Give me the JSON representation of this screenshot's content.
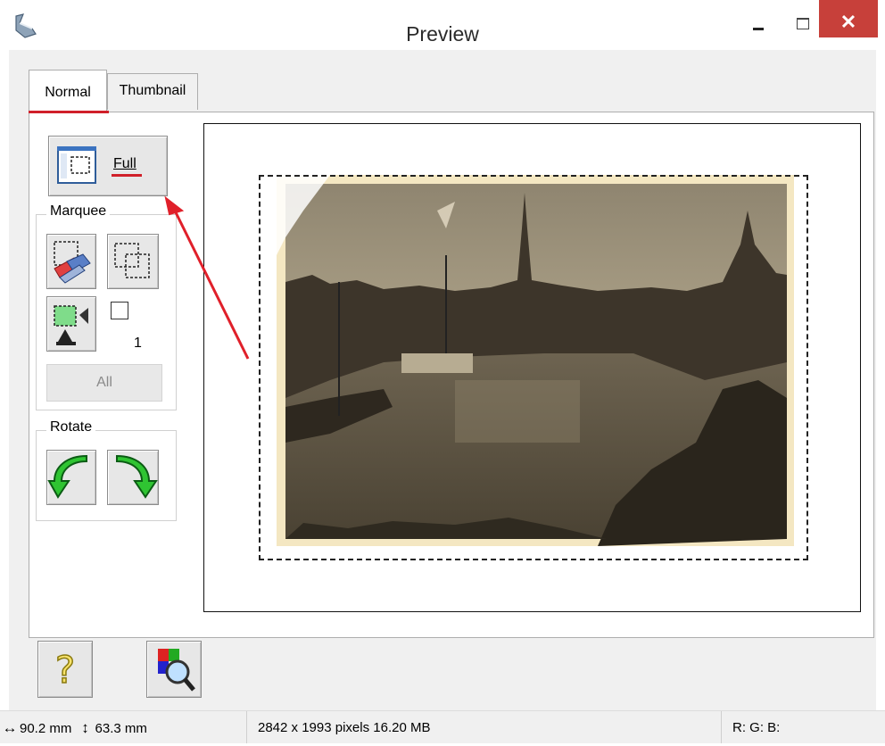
{
  "window": {
    "title": "Preview",
    "icons": {
      "app": "scanner-hand-icon",
      "minimize": "minimize-icon",
      "maximize": "maximize-icon",
      "close": "close-icon"
    },
    "close_glyph": "✕"
  },
  "tabs": [
    {
      "label": "Normal",
      "selected": true
    },
    {
      "label": "Thumbnail",
      "selected": false
    }
  ],
  "controls": {
    "full_button": {
      "label": "Full",
      "icon": "full-preview-icon"
    },
    "marquee": {
      "legend": "Marquee",
      "erase_icon": "erase-marquee-icon",
      "copy_icon": "copy-marquee-icon",
      "auto_exposure_icon": "auto-exposure-icon",
      "count": "1",
      "all_label": "All"
    },
    "rotate": {
      "legend": "Rotate",
      "left_icon": "rotate-left-icon",
      "right_icon": "rotate-right-icon"
    }
  },
  "preview": {
    "image": "sepia-harbor-photo",
    "marquee": "dashed-selection"
  },
  "bottom_buttons": {
    "help_icon": "help-icon",
    "color_icon": "color-palette-magnifier-icon"
  },
  "statusbar": {
    "width_icon": "↔",
    "width": "90.2 mm",
    "height_icon": "↕",
    "height": "63.3 mm",
    "pixels": "2842 x 1993 pixels 16.20 MB",
    "rgb": "R: G: B:"
  },
  "colors": {
    "accent_underline": "#d0202a",
    "close_button": "#c7403a",
    "annotation_arrow": "#e0202a"
  }
}
